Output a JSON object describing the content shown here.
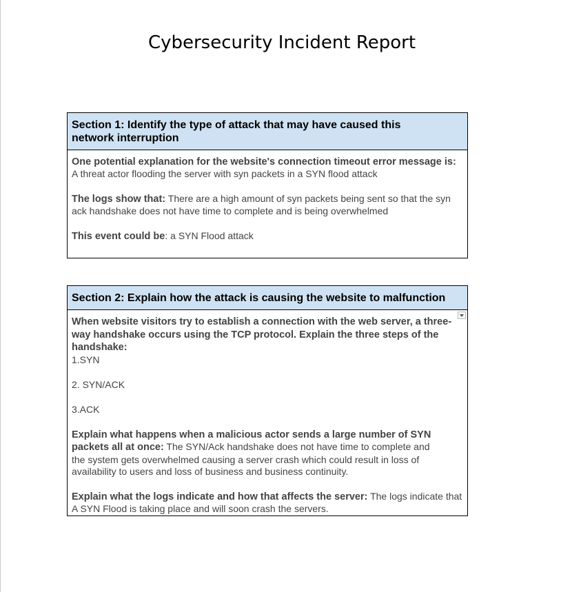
{
  "document": {
    "title": "Cybersecurity Incident Report"
  },
  "section1": {
    "header": "Section 1: Identify the type of attack that may have caused this network interruption",
    "explanation_label": "One potential explanation for the website's connection timeout error message is:",
    "explanation_value": "A threat actor flooding the server with syn packets in a SYN flood attack",
    "logs_label": "The logs show that:",
    "logs_value": " There are a high amount of syn packets being sent so that the syn ack handshake does not have time to complete and is being overwhelmed",
    "event_label": "This event could be",
    "event_value": ": a SYN Flood attack"
  },
  "section2": {
    "header": "Section 2: Explain how the attack is causing the website to malfunction",
    "handshake_prompt": "When website visitors try to establish a connection with the web server, a three-way handshake occurs using the TCP protocol. Explain the three steps of the handshake:",
    "steps": [
      "1.SYN",
      "2. SYN/ACK",
      "3.ACK"
    ],
    "malicious_label": "Explain what happens when a malicious actor sends a large number of SYN packets all at once:",
    "malicious_value": " The SYN/Ack handshake does not have time to complete and the system gets overwhelmed causing a server crash which could result in loss of availability to users and loss of business and business continuity.",
    "logs_label": "Explain what the logs indicate and how that affects the server:",
    "logs_value": " The logs indicate that A SYN Flood is taking place and will soon crash the servers."
  },
  "icons": {
    "dropdown": "chevron-down-icon"
  }
}
